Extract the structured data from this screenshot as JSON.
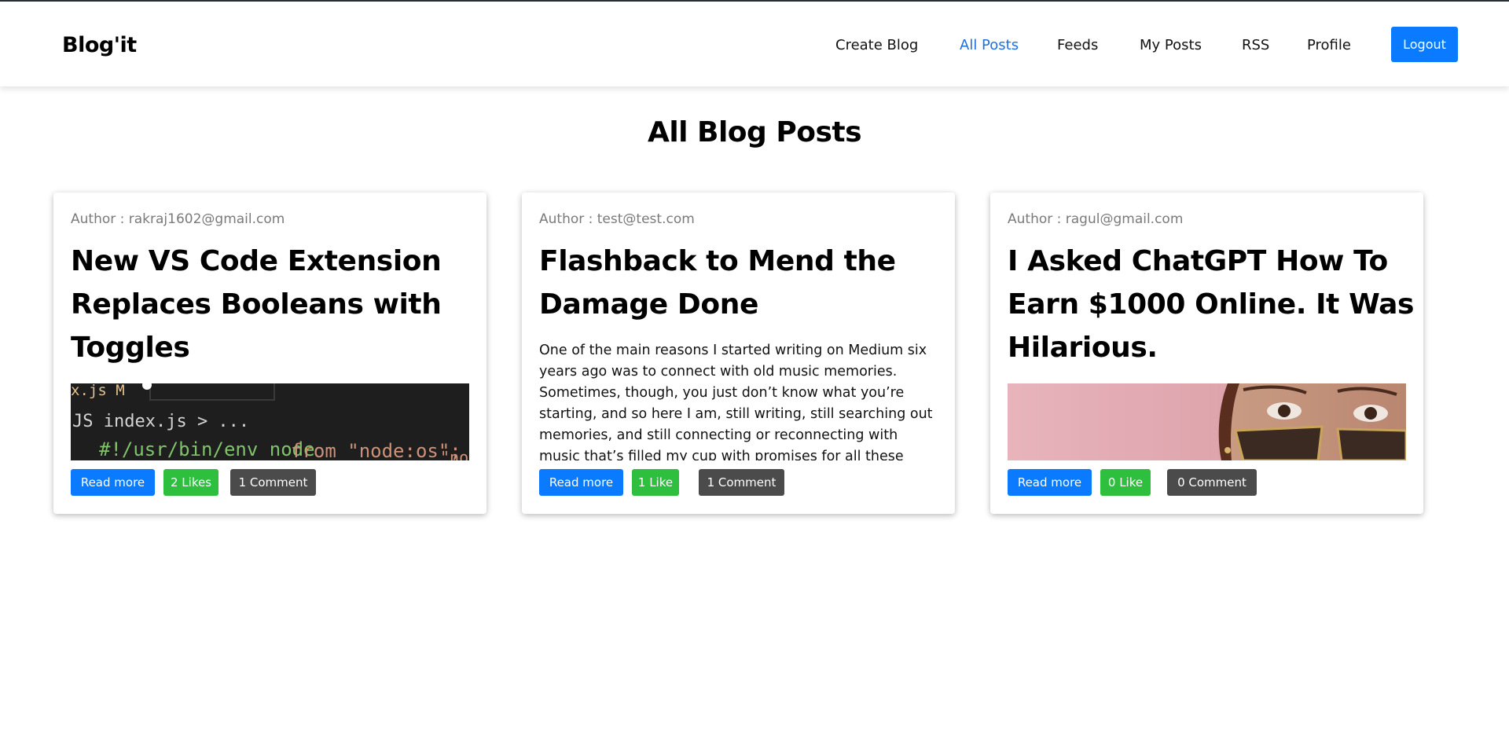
{
  "app": {
    "brand": "Blog'it"
  },
  "nav": {
    "items": [
      {
        "label": "Create Blog",
        "active": false
      },
      {
        "label": "All Posts",
        "active": true
      },
      {
        "label": "Feeds",
        "active": false
      },
      {
        "label": "My Posts",
        "active": false
      },
      {
        "label": "RSS",
        "active": false
      },
      {
        "label": "Profile",
        "active": false
      }
    ],
    "logout_label": "Logout"
  },
  "page": {
    "title": "All Blog Posts"
  },
  "posts": [
    {
      "author": "Author : rakraj1602@gmail.com",
      "title": "New VS Code Extension Replaces Booleans with Toggles",
      "media": "code-screenshot",
      "code_lines": [
        "x.js M",
        "JS index.js > ...",
        "#!/usr/bin/env node",
        "from \"node:os\";",
        "\"node"
      ],
      "read_more": "Read more",
      "likes": "2 Likes",
      "comments": "1 Comment"
    },
    {
      "author": "Author : test@test.com",
      "title": "Flashback to Mend the Damage Done",
      "excerpt": "One of the main reasons I started writing on Medium six years ago was to connect with old music memories. Sometimes, though, you just don’t know what you’re starting, and so here I am, still writing, still searching out memories, and still connecting or reconnecting with music that’s filled my cup with promises for all these",
      "read_more": "Read more",
      "likes": "1 Like",
      "comments": "1 Comment"
    },
    {
      "author": "Author : ragul@gmail.com",
      "title": "I Asked ChatGPT How To Earn $1000 Online. It Was Hilarious.",
      "media": "portrait-sunglasses",
      "read_more": "Read more",
      "likes": "0 Like",
      "comments": "0 Comment"
    }
  ],
  "colors": {
    "primary": "#0a7bff",
    "success": "#2fbf3f",
    "dark": "#4b4b4b",
    "nav_active": "#1f6fe0",
    "author_gray": "#7a7a7a"
  }
}
